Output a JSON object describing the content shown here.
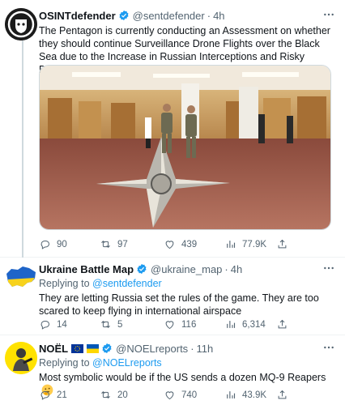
{
  "colors": {
    "accent": "#1d9bf0",
    "muted": "#536471",
    "text": "#0f1419",
    "verified": "#1d9bf0"
  },
  "tweets": [
    {
      "name": "OSINTdefender",
      "handle": "@sentdefender",
      "dot": "·",
      "time": "4h",
      "text": "The Pentagon is currently conducting an Assessment on whether they should continue Surveillance Drone Flights over the Black Sea due to the Increase in Russian Interceptions and Risky Behavior while in the Region.",
      "media_icon": "pentagon-hallway-photo",
      "stats": {
        "replies": "90",
        "retweets": "97",
        "likes": "439",
        "views": "77.9K"
      }
    },
    {
      "name": "Ukraine Battle Map",
      "handle": "@ukraine_map",
      "dot": "·",
      "time": "4h",
      "replying_prefix": "Replying to",
      "replying_to": "@sentdefender",
      "text": "They are letting Russia set the rules of the game. They are too scared to keep flying in international airspace",
      "stats": {
        "replies": "14",
        "retweets": "5",
        "likes": "116",
        "views": "6,314"
      }
    },
    {
      "name": "NOËL",
      "handle": "@NOELreports",
      "dot": "·",
      "time": "11h",
      "replying_prefix": "Replying to",
      "replying_to": "@NOELreports",
      "text": "Most symbolic would be if the US sends a dozen MQ-9 Reapers",
      "stats": {
        "replies": "21",
        "retweets": "20",
        "likes": "740",
        "views": "43.9K"
      }
    }
  ]
}
